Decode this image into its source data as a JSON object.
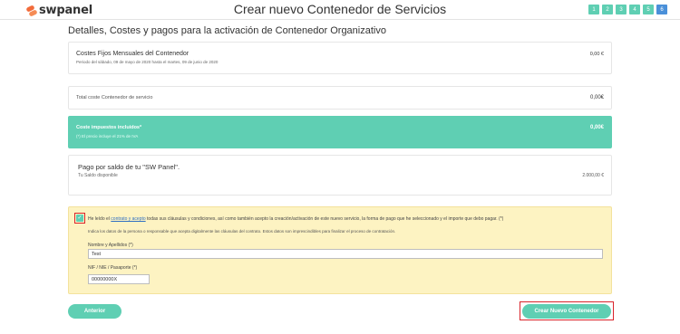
{
  "header": {
    "logo_text": "swpanel",
    "page_title": "Crear nuevo Contenedor de Servicios",
    "steps": [
      "1",
      "2",
      "3",
      "4",
      "5",
      "6"
    ],
    "active_step": "6"
  },
  "section_title": "Detalles, Costes y pagos para la activación de Contenedor Organizativo",
  "fixed_costs": {
    "title": "Costes Fijos Mensuales del Contenedor",
    "period": "Periodo del sábado, 09 de mayo de 2020 hasta el martes, 09 de junio de 2020",
    "value": "0,00 €"
  },
  "total_cost": {
    "label": "Total coste Contenedor de servicio",
    "value": "0,00€"
  },
  "taxes": {
    "label": "Coste impuestos incluidos*",
    "note": "(*) El precio incluye el 21% de IVA",
    "value": "0,00€"
  },
  "payment": {
    "title": "Pago por saldo de tu \"SW Panel\".",
    "balance_label": "Tu Saldo disponible",
    "balance_value": "2.000,00 €"
  },
  "terms": {
    "prefix": "He leído el",
    "link_text": "contrato y acepto",
    "suffix": "todas sus cláusulas y condiciones, así como también acepto la creación/activación de este nuevo servicio, la forma de pago que he seleccionado y el importe que debo pagar.  (*)",
    "note": "Indica los datos de la persona o responsable que acepta digitalmente las cláusulas del contrato. Estos datos son imprescindibles para finalizar el proceso de contratación.",
    "name_label": "Nombre y Apellidos (*)",
    "name_value": "Test",
    "nif_label": "NIF / NIE / Pasaporte (*)",
    "nif_value": "00000000X",
    "checked": true
  },
  "buttons": {
    "previous": "Anterior",
    "create": "Crear Nuevo Contenedor"
  },
  "colors": {
    "accent": "#5fcfb3",
    "active_step": "#4a90d9",
    "highlight_border": "#d9242b",
    "terms_background": "#fdf3c2"
  }
}
